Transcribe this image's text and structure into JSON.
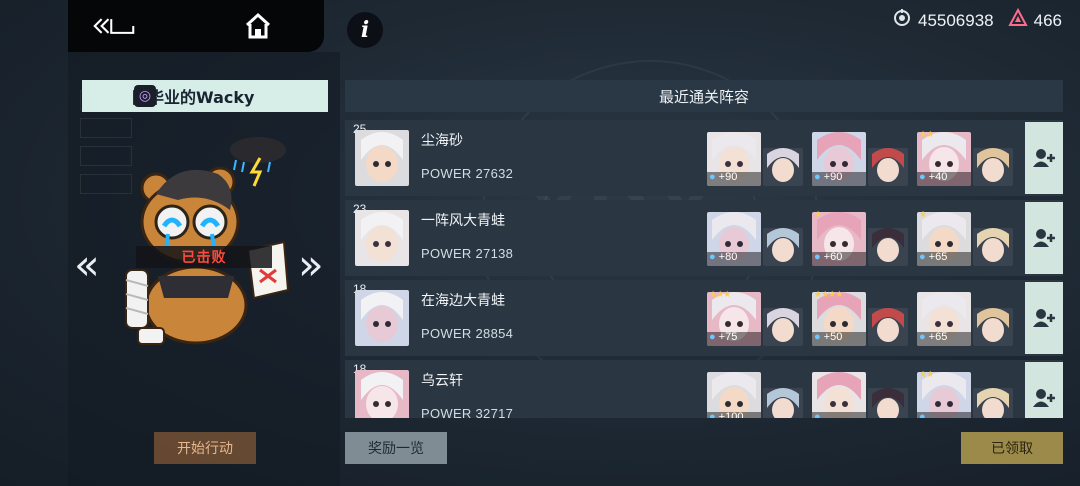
{
  "currency": {
    "coins_icon": "radar-icon",
    "coins": "45506938",
    "gems_icon": "triangle-gem-icon",
    "gems": "466"
  },
  "nav": {
    "back_icon": "back-icon",
    "home_icon": "home-icon",
    "info_label": "i"
  },
  "player": {
    "icon": "swirl-icon",
    "name": "刚毕业的Wacky",
    "status": "已击败"
  },
  "list": {
    "header": "最近通关阵容",
    "rows": [
      {
        "level": "25",
        "name": "尘海砂",
        "power": "POWER 27632",
        "teams": [
          {
            "stars": "",
            "value": "+90"
          },
          {
            "stars": "",
            "value": "+90"
          },
          {
            "stars": "★★",
            "value": "+40"
          }
        ]
      },
      {
        "level": "23",
        "name": "一阵风大青蛙",
        "power": "POWER 27138",
        "teams": [
          {
            "stars": "",
            "value": "+80"
          },
          {
            "stars": "★",
            "value": "+60"
          },
          {
            "stars": "★",
            "value": "+65"
          }
        ]
      },
      {
        "level": "18",
        "name": "在海边大青蛙",
        "power": "POWER 28854",
        "teams": [
          {
            "stars": "★★★",
            "value": "+75"
          },
          {
            "stars": "★★★★",
            "value": "+50"
          },
          {
            "stars": "",
            "value": "+65"
          }
        ]
      },
      {
        "level": "18",
        "name": "乌云轩",
        "power": "POWER 32717",
        "teams": [
          {
            "stars": "",
            "value": "+100"
          },
          {
            "stars": "",
            "value": ""
          },
          {
            "stars": "★★",
            "value": ""
          }
        ]
      }
    ]
  },
  "buttons": {
    "start": "开始行动",
    "rewards": "奖励一览",
    "claimed": "已领取"
  },
  "colors": {
    "accent_mint": "#d6ede8",
    "defeated_red": "#ff4a3d",
    "start_orange": "#aa6e3c",
    "claimed_gold": "#9c8a4a"
  }
}
